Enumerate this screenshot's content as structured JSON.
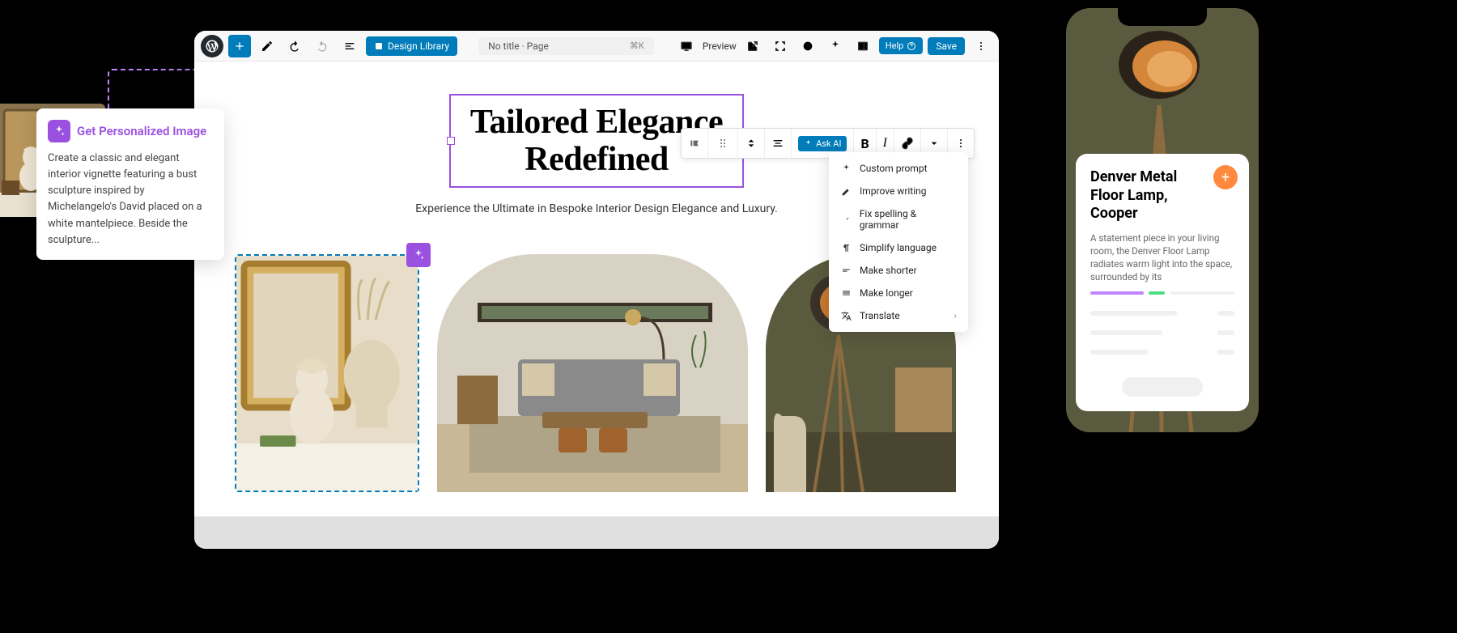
{
  "toolbar": {
    "design_library": "Design Library",
    "doc_title": "No title · Page",
    "shortcut": "⌘K",
    "preview": "Preview",
    "help": "Help",
    "save": "Save"
  },
  "page": {
    "heading": "Tailored Elegance Redefined",
    "subheading": "Experience the Ultimate in Bespoke Interior Design Elegance and Luxury."
  },
  "selection_toolbar": {
    "ask_ai": "Ask AI"
  },
  "context_menu": {
    "items": [
      "Custom prompt",
      "Improve writing",
      "Fix spelling & grammar",
      "Simplify language",
      "Make shorter",
      "Make longer",
      "Translate"
    ]
  },
  "personalized_image": {
    "title": "Get Personalized Image",
    "description": "Create a classic and elegant interior vignette featuring a bust sculpture inspired by Michelangelo's David placed on a white mantelpiece. Beside the sculpture..."
  },
  "phone": {
    "product_title": "Denver Metal Floor Lamp, Cooper",
    "product_desc": "A statement piece in your living room, the Denver Floor Lamp radiates warm light into the space, surrounded by its"
  },
  "colors": {
    "accent": "#007cba",
    "ai": "#9b51e0",
    "fab": "#ff8a3d",
    "prog1": "#c084fc",
    "prog2": "#4ade80"
  }
}
